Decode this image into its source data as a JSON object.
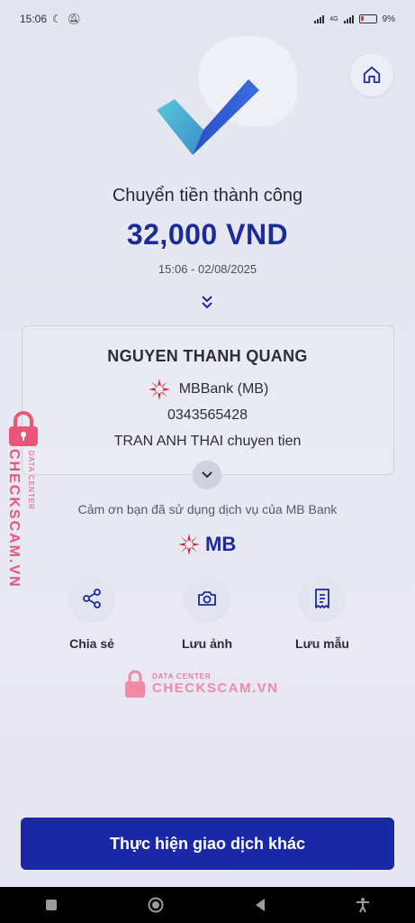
{
  "status": {
    "time": "15:06",
    "battery": "9%",
    "network": "4G"
  },
  "result": {
    "title": "Chuyển tiền thành công",
    "amount": "32,000 VND",
    "datetime": "15:06 - 02/08/2025"
  },
  "recipient": {
    "name": "NGUYEN THANH QUANG",
    "bank": "MBBank (MB)",
    "account": "0343565428",
    "note": "TRAN ANH THAI chuyen tien"
  },
  "thanks": "Cảm ơn bạn đã sử dụng dịch vụ của MB Bank",
  "brand": {
    "logo_text": "MB",
    "primary_color": "#1a28a6",
    "accent_red": "#d3263a"
  },
  "actions": [
    {
      "label": "Chia sẻ",
      "icon": "share-icon"
    },
    {
      "label": "Lưu ảnh",
      "icon": "camera-icon"
    },
    {
      "label": "Lưu mẫu",
      "icon": "receipt-icon"
    }
  ],
  "watermark": {
    "small": "DATA CENTER",
    "big": "CHECKSCAM.VN",
    "side_big": "CHECKSCAM.VN",
    "side_small": "DATA CENTER"
  },
  "primary_button": "Thực hiện giao dịch khác"
}
